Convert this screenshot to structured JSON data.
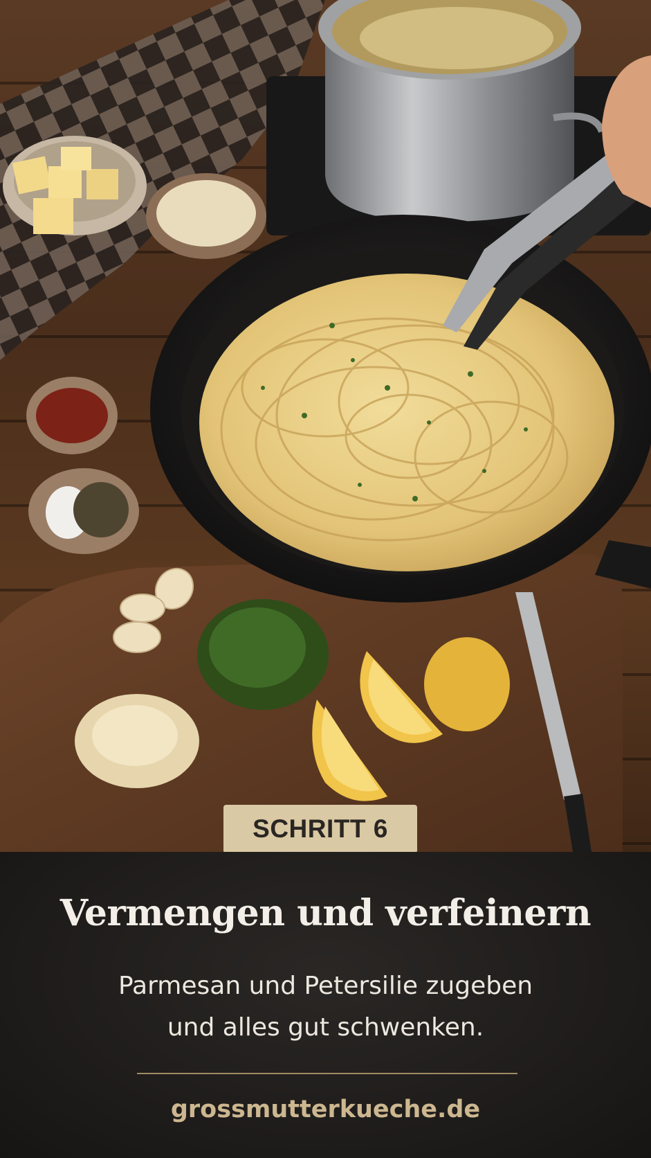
{
  "step": {
    "label": "SCHRITT 6"
  },
  "heading": "Vermengen und verfeinern",
  "description": {
    "line1": "Parmesan und Petersilie zugeben",
    "line2": "und alles gut schwenken."
  },
  "footer": {
    "site": "grossmutterkueche.de"
  },
  "colors": {
    "panel_background": "#1d1b19",
    "badge_background": "#d9c9a4",
    "accent_text": "#cdb790",
    "divider": "#a08a63"
  }
}
